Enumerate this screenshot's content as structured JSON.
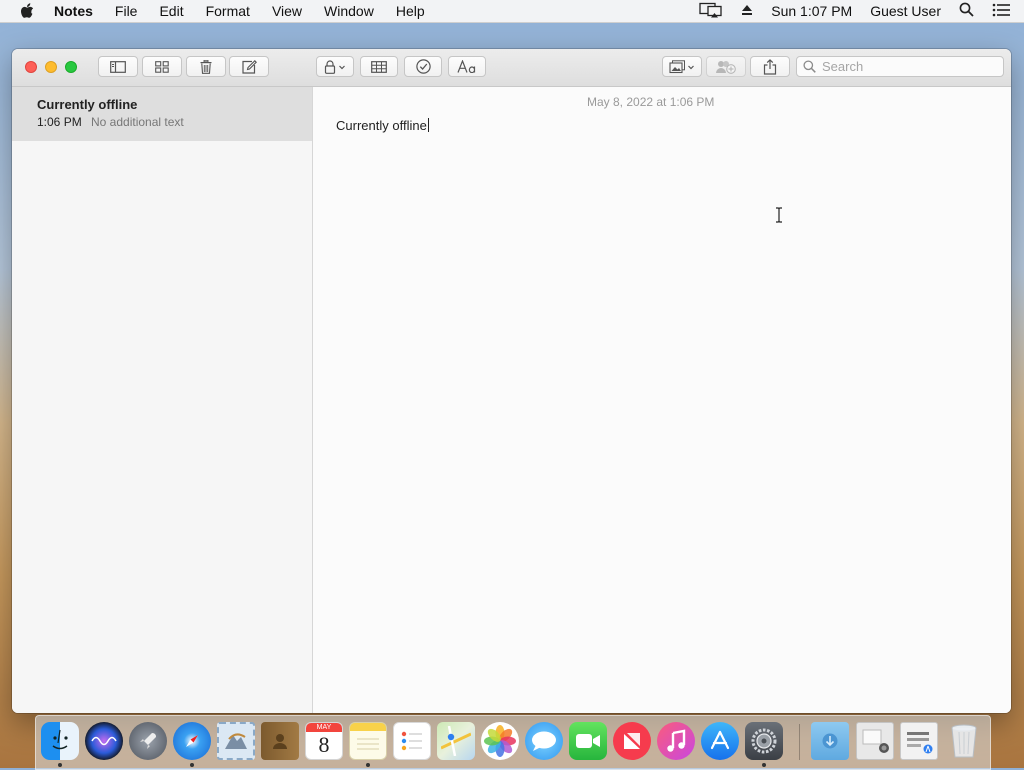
{
  "menubar": {
    "app_name": "Notes",
    "menus": [
      "File",
      "Edit",
      "Format",
      "View",
      "Window",
      "Help"
    ],
    "clock": "Sun 1:07 PM",
    "user": "Guest User"
  },
  "toolbar": {
    "search_placeholder": "Search"
  },
  "notes": [
    {
      "title": "Currently offline",
      "time": "1:06 PM",
      "preview": "No additional text"
    }
  ],
  "editor": {
    "date": "May 8, 2022 at 1:06 PM",
    "body": "Currently offline"
  },
  "colors": {
    "close": "#fe5f57",
    "minimize": "#febc2e",
    "zoom": "#28c840",
    "selected_row": "#dedede"
  },
  "dock": {
    "apps": [
      "finder-icon",
      "siri-icon",
      "launchpad-icon",
      "safari-icon",
      "mail-icon",
      "contacts-icon",
      "calendar-icon",
      "notes-icon",
      "reminders-icon",
      "maps-icon",
      "photos-icon",
      "messages-icon",
      "facetime-icon",
      "news-icon",
      "music-icon",
      "app-store-icon",
      "system-preferences-icon",
      "downloads-folder-icon",
      "preview-stack-icon",
      "documents-stack-icon",
      "trash-icon"
    ],
    "calendar_month": "MAY",
    "calendar_day": "8"
  }
}
